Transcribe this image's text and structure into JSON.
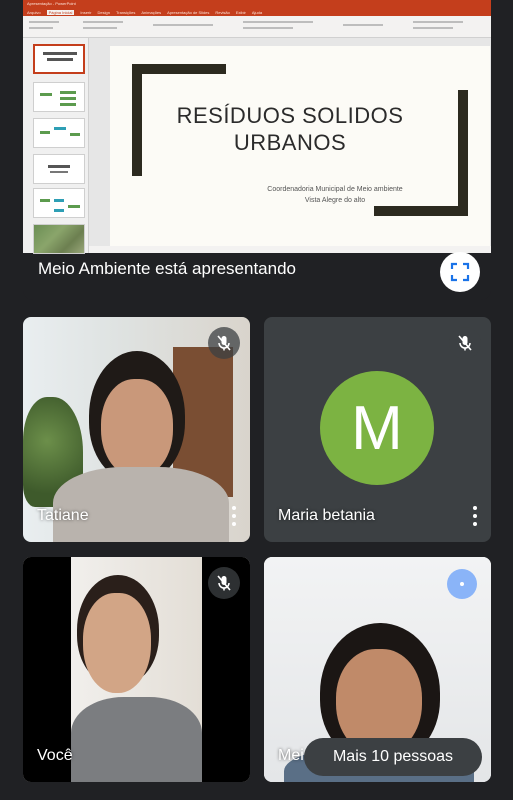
{
  "presentation": {
    "app_window_title": "Apresentação - PowerPoint",
    "ribbon_tabs": [
      "Arquivo",
      "Página Inicial",
      "Inserir",
      "Design",
      "Transições",
      "Animações",
      "Apresentação de Slides",
      "Revisão",
      "Exibir",
      "Ajuda"
    ],
    "active_tab": "Página Inicial",
    "slide_title": "RESÍDUOS SOLIDOS URBANOS",
    "slide_subtitle_line1": "Coordenadoria Municipal de Meio ambiente",
    "slide_subtitle_line2": "Vista Alegre do alto",
    "presenter_caption": "Meio Ambiente está apresentando",
    "fullscreen_icon": "fullscreen-icon"
  },
  "participants": [
    {
      "name": "Tatiane",
      "muted": true,
      "has_video": true
    },
    {
      "name": "Maria betania",
      "muted": true,
      "has_video": false,
      "avatar_letter": "M",
      "avatar_color": "#7cb342"
    },
    {
      "name": "Você",
      "muted": true,
      "has_video": true
    },
    {
      "name": "Mei",
      "muted": false,
      "has_video": true
    }
  ],
  "more_people_label": "Mais 10 pessoas",
  "colors": {
    "background": "#202124",
    "tile": "#3c4043",
    "ppt_accent": "#c43e1c",
    "avatar_green": "#7cb342",
    "speaking_blue": "#8ab4f8"
  }
}
